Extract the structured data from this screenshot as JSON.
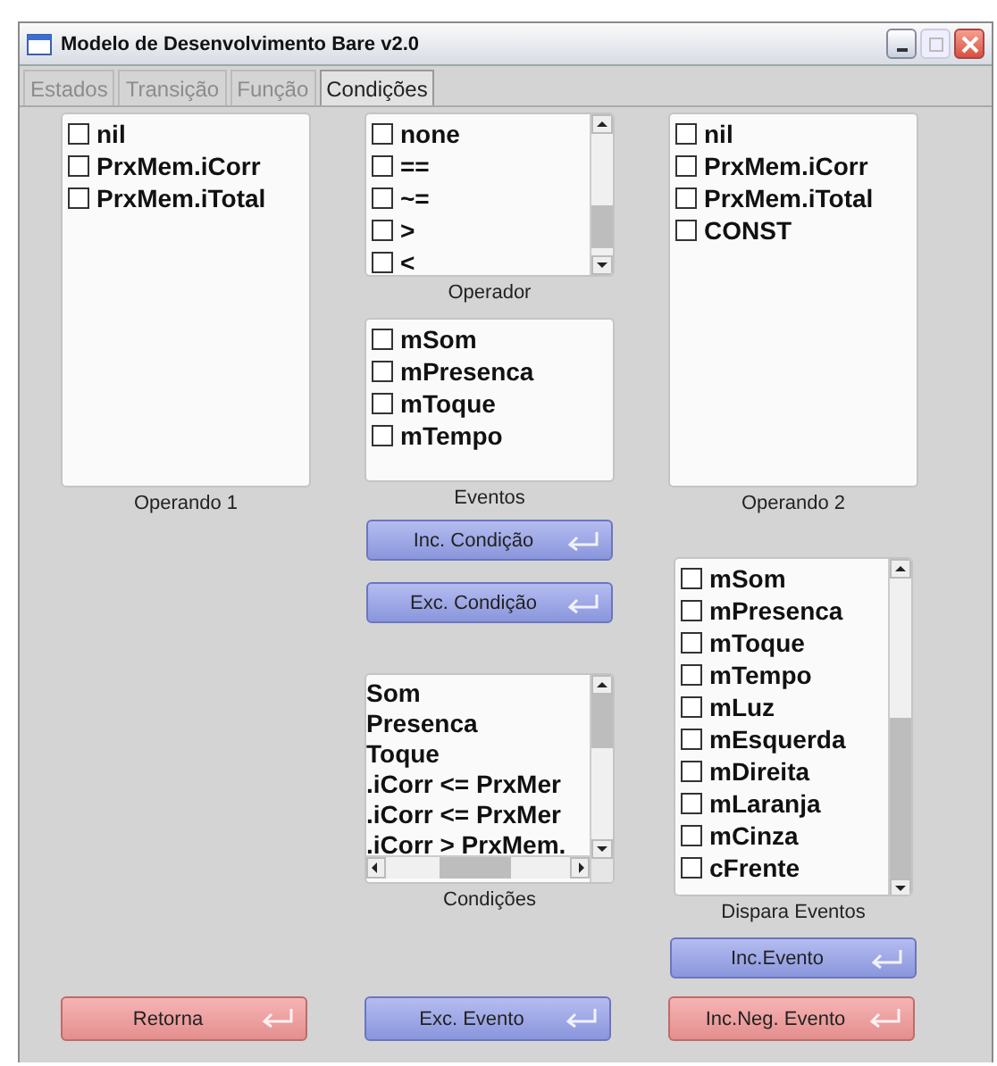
{
  "window": {
    "title": "Modelo de Desenvolvimento Bare v2.0"
  },
  "tabs": [
    {
      "label": "Estados",
      "selected": false,
      "disabled": true
    },
    {
      "label": "Transição",
      "selected": false,
      "disabled": true
    },
    {
      "label": "Função",
      "selected": false,
      "disabled": true
    },
    {
      "label": "Condições",
      "selected": true,
      "disabled": false
    }
  ],
  "operando_1": {
    "label": "Operando 1",
    "items": [
      {
        "text": "nil",
        "checked": false
      },
      {
        "text": "PrxMem.iCorr",
        "checked": false
      },
      {
        "text": "PrxMem.iTotal",
        "checked": false
      }
    ]
  },
  "operador": {
    "label": "Operador",
    "items": [
      {
        "text": "none",
        "checked": false
      },
      {
        "text": "==",
        "checked": false
      },
      {
        "text": "~=",
        "checked": false
      },
      {
        "text": ">",
        "checked": false
      },
      {
        "text": "<",
        "checked": false
      }
    ]
  },
  "eventos": {
    "label": "Eventos",
    "items": [
      {
        "text": "mSom",
        "checked": false
      },
      {
        "text": "mPresenca",
        "checked": false
      },
      {
        "text": "mToque",
        "checked": false
      },
      {
        "text": "mTempo",
        "checked": false
      }
    ]
  },
  "condition_buttons": [
    {
      "label": "Inc. Condição",
      "kind": "action"
    },
    {
      "label": "Exc. Condição",
      "kind": "action"
    }
  ],
  "condicoes": {
    "label": "Condições",
    "items": [
      "Som",
      "Presenca",
      "Toque",
      ".iCorr <= PrxMer",
      ".iCorr <= PrxMer",
      ".iCorr > PrxMem."
    ]
  },
  "operando_2": {
    "label": "Operando 2",
    "items": [
      {
        "text": "nil",
        "checked": false
      },
      {
        "text": "PrxMem.iCorr",
        "checked": false
      },
      {
        "text": "PrxMem.iTotal",
        "checked": false
      },
      {
        "text": "CONST",
        "checked": false
      }
    ]
  },
  "dispara_eventos": {
    "label": "Dispara Eventos",
    "items": [
      {
        "text": "mSom",
        "checked": false
      },
      {
        "text": "mPresenca",
        "checked": false
      },
      {
        "text": "mToque",
        "checked": false
      },
      {
        "text": "mTempo",
        "checked": false
      },
      {
        "text": "mLuz",
        "checked": false
      },
      {
        "text": "mEsquerda",
        "checked": false
      },
      {
        "text": "mDireita",
        "checked": false
      },
      {
        "text": "mLaranja",
        "checked": false
      },
      {
        "text": "mCinza",
        "checked": false
      },
      {
        "text": "cFrente",
        "checked": false
      }
    ]
  },
  "event_button": {
    "label": "Inc.Evento",
    "kind": "action"
  },
  "bottom_buttons": [
    {
      "label": "Retorna",
      "kind": "warning"
    },
    {
      "label": "Exc. Evento",
      "kind": "action"
    },
    {
      "label": "Inc.Neg. Evento",
      "kind": "warning"
    }
  ]
}
